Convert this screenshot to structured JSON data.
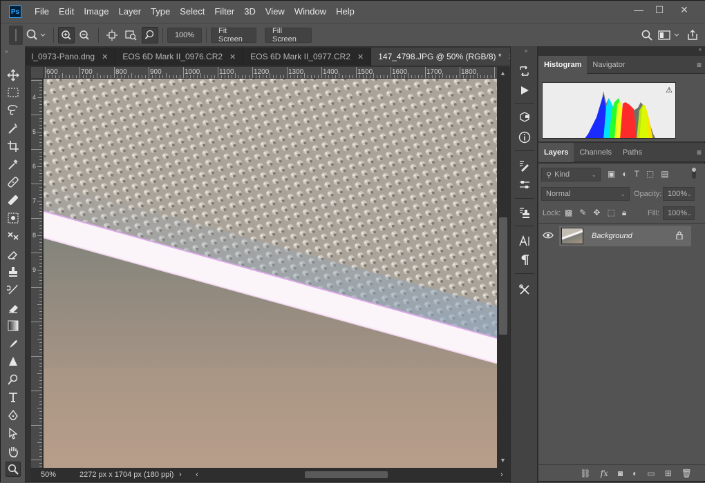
{
  "app": {
    "logo": "Ps"
  },
  "menu": [
    "File",
    "Edit",
    "Image",
    "Layer",
    "Type",
    "Select",
    "Filter",
    "3D",
    "View",
    "Window",
    "Help"
  ],
  "window_controls": {
    "minimize": "—",
    "maximize": "☐",
    "close": "✕"
  },
  "options": {
    "zoom_value": "100%",
    "fit_screen": "Fit Screen",
    "fill_screen": "Fill Screen"
  },
  "tabs": [
    {
      "label": "I_0973-Pano.dng",
      "close": "✕",
      "active": false
    },
    {
      "label": "EOS 6D Mark II_0976.CR2",
      "close": "✕",
      "active": false
    },
    {
      "label": "EOS 6D Mark II_0977.CR2",
      "close": "✕",
      "active": false
    },
    {
      "label": "147_4798.JPG @ 50% (RGB/8) *",
      "close": "✕",
      "active": true
    }
  ],
  "tab_overflow": "»",
  "ruler_top": [
    "600",
    "700",
    "800",
    "900",
    "1000",
    "1100",
    "1200",
    "1300",
    "1400",
    "1500",
    "1600",
    "1700",
    "1800"
  ],
  "ruler_left": [
    "4",
    "5",
    "6",
    "7",
    "8",
    "9"
  ],
  "status": {
    "zoom": "50%",
    "doc_info": "2272 px x 1704 px (180 ppi)",
    "arrow": "›",
    "left_arrow": "‹",
    "right_arrow": "›"
  },
  "panels": {
    "top_tabs": [
      {
        "label": "Histogram",
        "active": true
      },
      {
        "label": "Navigator",
        "active": false
      }
    ],
    "layers_tabs": [
      {
        "label": "Layers",
        "active": true
      },
      {
        "label": "Channels",
        "active": false
      },
      {
        "label": "Paths",
        "active": false
      }
    ],
    "kind_label": "Kind",
    "blend_mode": "Normal",
    "opacity_label": "Opacity:",
    "opacity_value": "100%",
    "lock_label": "Lock:",
    "fill_label": "Fill:",
    "fill_value": "100%",
    "layer_name": "Background"
  },
  "colors": {
    "accent": "#31a8ff",
    "bg": "#535353",
    "dark": "#323232"
  }
}
